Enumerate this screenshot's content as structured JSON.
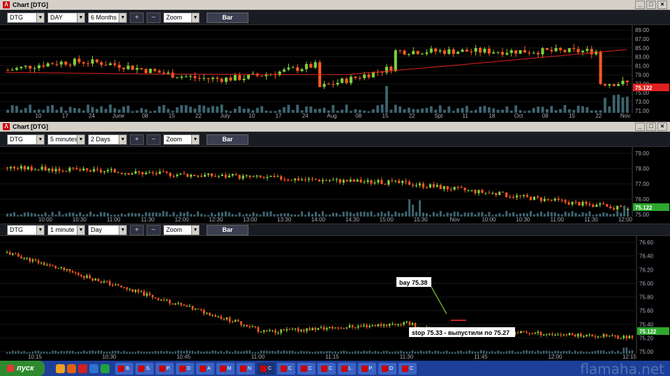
{
  "panels": [
    {
      "title": "Chart [DTG]",
      "symbol": "DTG",
      "interval": "DAY",
      "range": "6 Months",
      "zoom": "Zoom",
      "bar_label": "Bar",
      "price_tag": "75.122",
      "price_tag_color": "#e02020",
      "y_labels": [
        "89.00",
        "87.00",
        "85.00",
        "83.00",
        "81.00",
        "79.00",
        "77.00",
        "75.00",
        "73.00",
        "71.00"
      ],
      "x_labels": [
        "10",
        "17",
        "24",
        "June",
        "08",
        "15",
        "22",
        "July",
        "10",
        "17",
        "24",
        "Aug",
        "08",
        "15",
        "22",
        "Spt",
        "11",
        "18",
        "Oct",
        "08",
        "15",
        "22",
        "Nov"
      ]
    },
    {
      "title": "Chart [DTG]",
      "symbol": "DTG",
      "interval": "5 minutes",
      "range": "2 Days",
      "zoom": "Zoom",
      "bar_label": "Bar",
      "price_tag": "75.122",
      "price_tag_color": "#2ea82e",
      "y_labels": [
        "79.00",
        "78.00",
        "77.00",
        "76.00",
        "75.00"
      ],
      "x_labels": [
        "10:00",
        "10:30",
        "11:00",
        "11:30",
        "12:00",
        "12:30",
        "13:00",
        "13:30",
        "14:00",
        "14:30",
        "15:00",
        "15:30",
        "Nov",
        "10:00",
        "10:30",
        "11:00",
        "11:30",
        "12:00"
      ]
    },
    {
      "symbol": "DTG",
      "interval": "1 minute",
      "range": "Day",
      "zoom": "Zoom",
      "bar_label": "Bar",
      "price_tag": "75.122",
      "price_tag_color": "#2ea82e",
      "y_labels": [
        "76.60",
        "76.40",
        "76.20",
        "76.00",
        "75.80",
        "75.60",
        "75.40",
        "75.20",
        "75.00"
      ],
      "x_labels": [
        "10:15",
        "10:30",
        "10:45",
        "11:00",
        "11:15",
        "11:30",
        "11:45",
        "12:00",
        "12:15"
      ],
      "annotations": {
        "buy": "bay 75.38",
        "stop": "stop 75.33 - выпустили по 75.27"
      }
    }
  ],
  "window_buttons": [
    "_",
    "□",
    "×"
  ],
  "taskbar": {
    "start_label": "пуск",
    "tasks": [
      "B.",
      "S.",
      "P.",
      "D",
      "A",
      "M",
      "N",
      "C",
      "C",
      "C",
      "C",
      "L.",
      "P.",
      "O",
      "C"
    ],
    "watermark": "flamaha.net"
  },
  "colors": {
    "up": "#7fd03a",
    "down": "#ff5a1f",
    "ma": "#e02020",
    "volume": "#3d6470",
    "bg": "#000000",
    "grid": "#2a2a2a"
  }
}
